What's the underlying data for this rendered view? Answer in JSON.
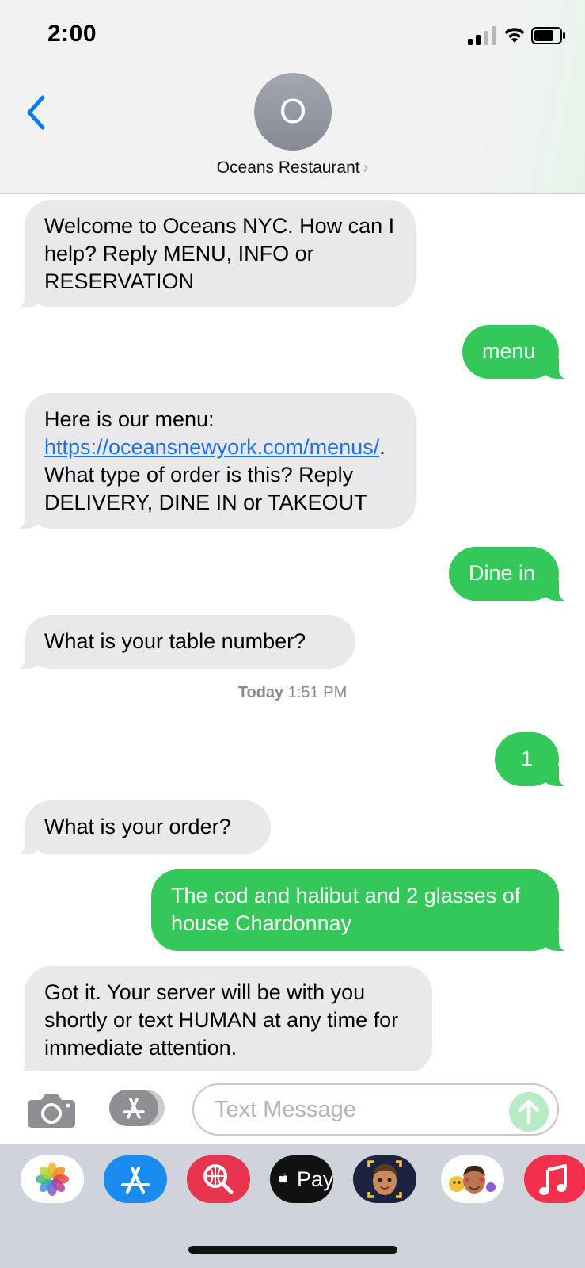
{
  "status_bar": {
    "time": "2:00"
  },
  "header": {
    "avatar_initial": "O",
    "contact_name": "Oceans Restaurant",
    "chevron": "›"
  },
  "messages": [
    {
      "dir": "in",
      "text": "Welcome to Oceans NYC.  How can I help? Reply MENU, INFO or RESERVATION"
    },
    {
      "dir": "out",
      "text": "menu"
    },
    {
      "dir": "in",
      "text_before": "Here is our menu: ",
      "link": "https://oceansnewyork.com/menus/",
      "text_after": ". What type of order is this? Reply DELIVERY, DINE IN or TAKEOUT"
    },
    {
      "dir": "out",
      "text": "Dine in"
    },
    {
      "dir": "in",
      "text": "What is your table number?"
    },
    {
      "dir": "out",
      "text": "1"
    },
    {
      "dir": "in",
      "text": "What is your order?"
    },
    {
      "dir": "out",
      "text": "The cod and halibut and 2 glasses of house Chardonnay"
    },
    {
      "dir": "in",
      "text": "Got it.  Your server will be with you shortly or text HUMAN at any time for immediate attention."
    }
  ],
  "timestamp": {
    "day": "Today",
    "time": "1:51 PM"
  },
  "composer": {
    "placeholder": "Text Message"
  },
  "drawer": {
    "apps": [
      {
        "icon": "photos-icon"
      },
      {
        "icon": "app-store-icon"
      },
      {
        "icon": "images-search-icon"
      },
      {
        "icon": "apple-pay-icon",
        "label": "Pay"
      },
      {
        "icon": "memoji-icon"
      },
      {
        "icon": "memoji-stickers-icon"
      },
      {
        "icon": "music-icon"
      }
    ]
  },
  "colors": {
    "outgoing": "#34c759",
    "incoming": "#e9e9eb",
    "link": "#1a73e8",
    "accent": "#007aff"
  }
}
